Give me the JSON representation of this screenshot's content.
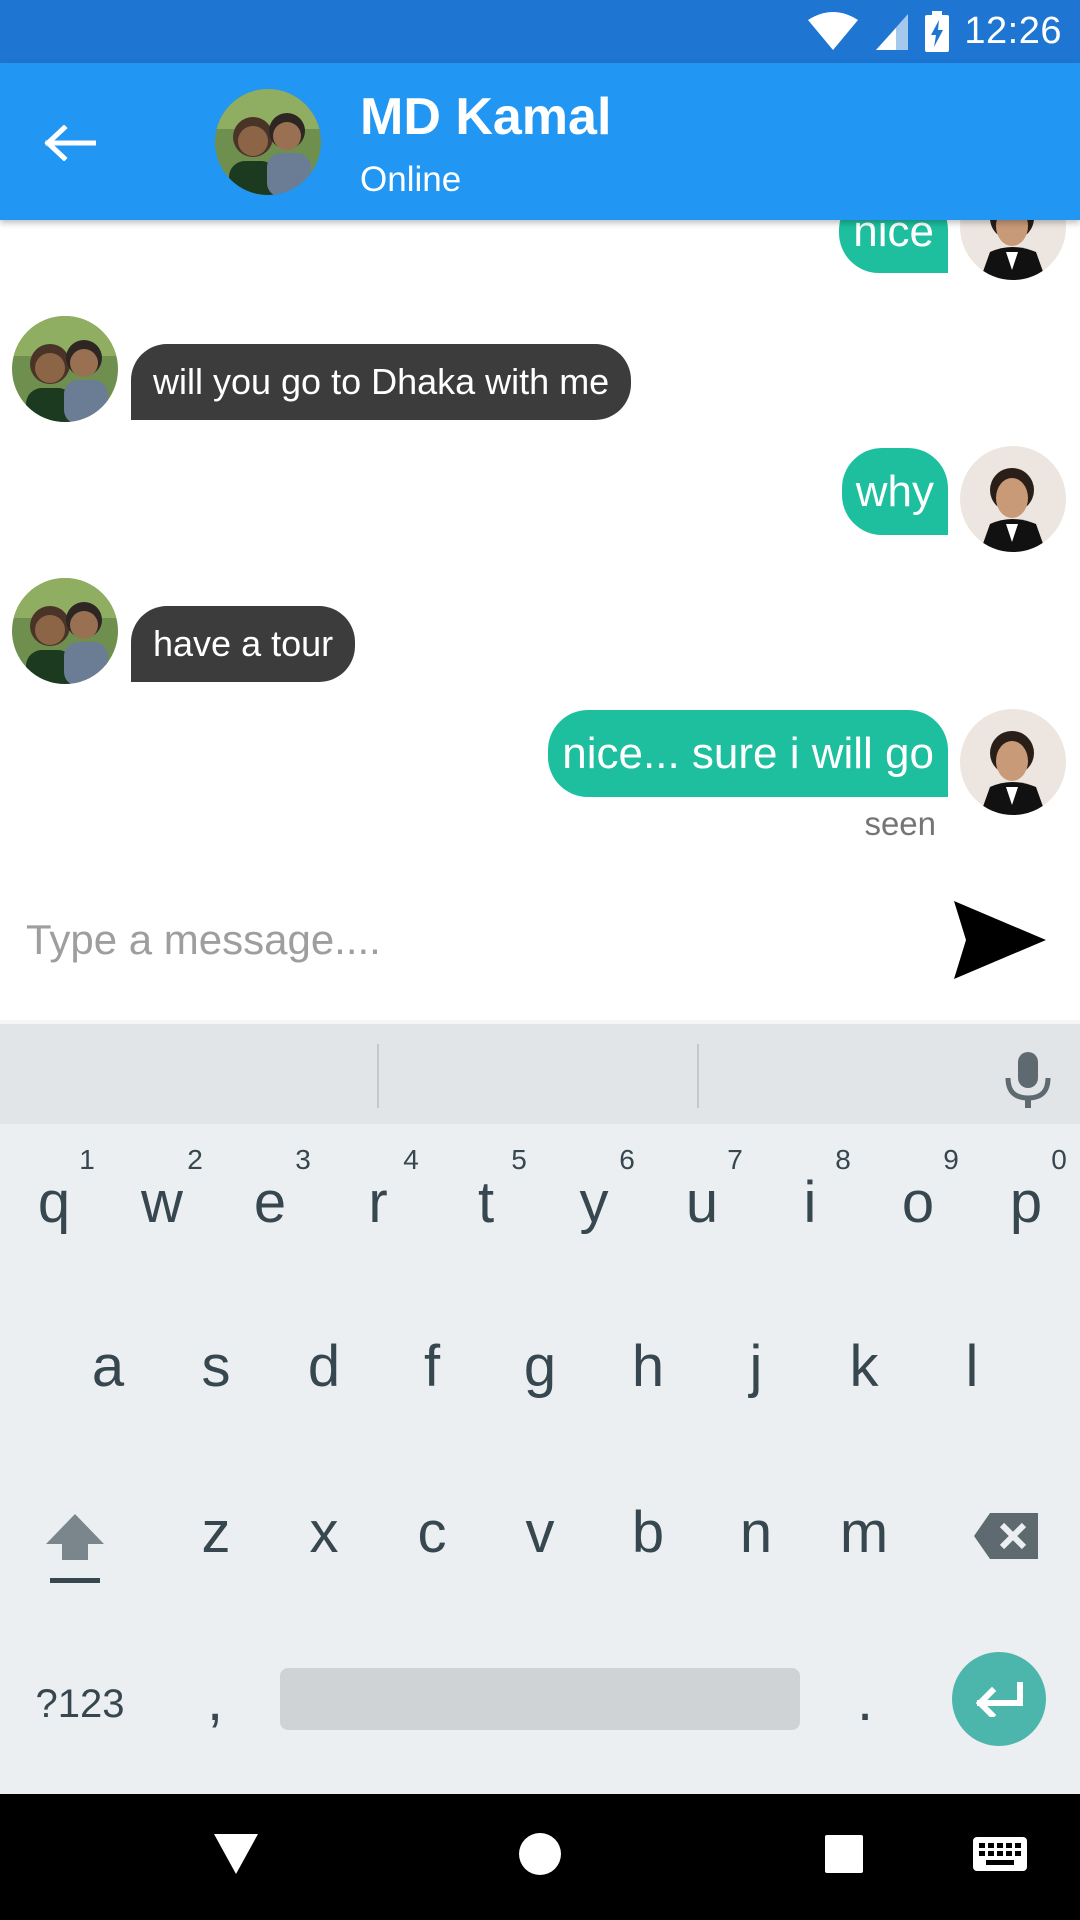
{
  "status_bar": {
    "time": "12:26"
  },
  "header": {
    "back_label": "back",
    "name": "MD Kamal",
    "status": "Online"
  },
  "messages": [
    {
      "direction": "out",
      "text": "nice"
    },
    {
      "direction": "in",
      "text": "will you go to Dhaka with me"
    },
    {
      "direction": "out",
      "text": "why"
    },
    {
      "direction": "in",
      "text": "have a tour"
    },
    {
      "direction": "out",
      "text": "nice... sure i will go"
    }
  ],
  "seen_label": "seen",
  "composer": {
    "placeholder": "Type a message...."
  },
  "keyboard": {
    "row1": [
      "q",
      "w",
      "e",
      "r",
      "t",
      "y",
      "u",
      "i",
      "o",
      "p"
    ],
    "row1_hints": [
      "1",
      "2",
      "3",
      "4",
      "5",
      "6",
      "7",
      "8",
      "9",
      "0"
    ],
    "row2": [
      "a",
      "s",
      "d",
      "f",
      "g",
      "h",
      "j",
      "k",
      "l"
    ],
    "row3": [
      "z",
      "x",
      "c",
      "v",
      "b",
      "n",
      "m"
    ],
    "symbols_label": "?123",
    "comma": ",",
    "period": "."
  },
  "colors": {
    "status_bar": "#1E76D2",
    "app_bar": "#2196F3",
    "bubble_in": "#3C3C3C",
    "bubble_out": "#1DBF9F",
    "enter": "#4DB6AC"
  }
}
